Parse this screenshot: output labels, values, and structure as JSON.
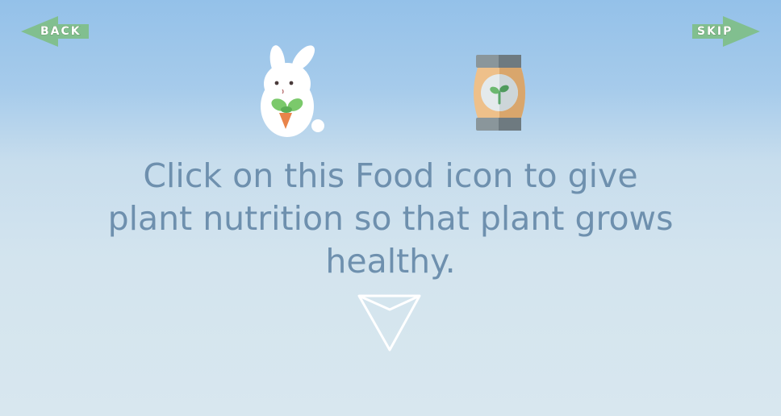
{
  "nav": {
    "back_label": "BACK",
    "skip_label": "SKIP"
  },
  "tutorial": {
    "instruction": "Click on this Food icon to give plant nutrition so that plant grows healthy."
  },
  "icons": {
    "mascot": "bunny-holding-carrot-icon",
    "food": "plant-food-jar-icon",
    "pointer": "down-arrow-icon"
  },
  "colors": {
    "nav_arrow": "#7fbf8a",
    "instruction_text": "#6e90ae",
    "jar_body": "#e8b97c",
    "jar_lid": "#7f8a8f",
    "sprout": "#5aa66a"
  }
}
